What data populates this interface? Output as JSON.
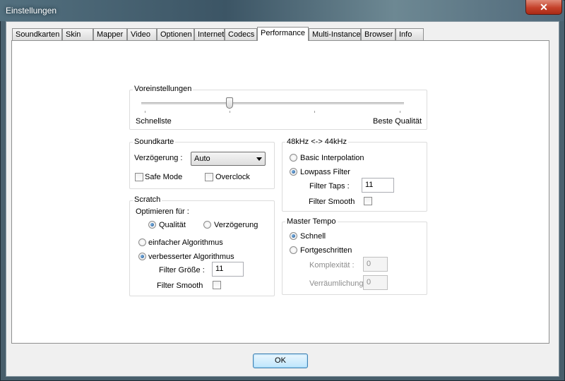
{
  "window": {
    "title": "Einstellungen",
    "close_glyph": "✕"
  },
  "tabs": [
    {
      "label": "Soundkarten"
    },
    {
      "label": "Skin"
    },
    {
      "label": "Mapper"
    },
    {
      "label": "Video"
    },
    {
      "label": "Optionen"
    },
    {
      "label": "Internet"
    },
    {
      "label": "Codecs"
    },
    {
      "label": "Performance"
    },
    {
      "label": "Multi-Instance"
    },
    {
      "label": "Browser"
    },
    {
      "label": "Info"
    }
  ],
  "active_tab": "Performance",
  "presets": {
    "title": "Voreinstellungen",
    "left_label": "Schnellste",
    "right_label": "Beste Qualität",
    "slider_position": 0.33
  },
  "soundcard": {
    "title": "Soundkarte",
    "latency_label": "Verzögerung :",
    "latency_value": "Auto",
    "safe_mode_label": "Safe Mode",
    "safe_mode_checked": false,
    "overclock_label": "Overclock",
    "overclock_checked": false
  },
  "scratch": {
    "title": "Scratch",
    "optimize_label": "Optimieren für :",
    "quality_label": "Qualität",
    "quality_selected": true,
    "latency_label": "Verzögerung",
    "latency_selected": false,
    "simple_algo_label": "einfacher Algorithmus",
    "simple_algo_selected": false,
    "improved_algo_label": "verbesserter Algorithmus",
    "improved_algo_selected": true,
    "filter_size_label": "Filter Größe :",
    "filter_size_value": "11",
    "filter_smooth_label": "Filter Smooth",
    "filter_smooth_checked": false
  },
  "resample": {
    "title": "48kHz <-> 44kHz",
    "basic_label": "Basic Interpolation",
    "basic_selected": false,
    "lowpass_label": "Lowpass Filter",
    "lowpass_selected": true,
    "taps_label": "Filter Taps :",
    "taps_value": "11",
    "smooth_label": "Filter Smooth",
    "smooth_checked": false
  },
  "master_tempo": {
    "title": "Master Tempo",
    "fast_label": "Schnell",
    "fast_selected": true,
    "advanced_label": "Fortgeschritten",
    "advanced_selected": false,
    "complexity_label": "Komplexität :",
    "complexity_value": "0",
    "spatial_label": "Verräumlichung",
    "spatial_value": "0"
  },
  "ok_label": "OK"
}
